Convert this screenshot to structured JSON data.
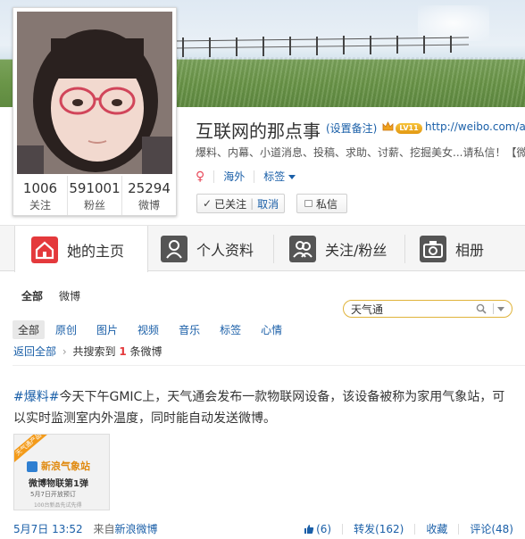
{
  "profile": {
    "name": "互联网的那点事",
    "set_remark": "(设置备注)",
    "level": "LV11",
    "url": "http://weibo.com/alib",
    "description": "爆料、内幕、小道消息、投稿、求助、讨薪、挖掘美女...请私信！【微",
    "location": "海外",
    "tags_label": "标签",
    "followed_label": "已关注",
    "cancel_label": "取消",
    "message_label": "私信"
  },
  "stats": [
    {
      "value": "1006",
      "label": "关注"
    },
    {
      "value": "591001",
      "label": "粉丝"
    },
    {
      "value": "25294",
      "label": "微博"
    }
  ],
  "tabs": [
    {
      "label": "她的主页",
      "icon": "home-icon"
    },
    {
      "label": "个人资料",
      "icon": "person-icon"
    },
    {
      "label": "关注/粉丝",
      "icon": "people-icon"
    },
    {
      "label": "相册",
      "icon": "camera-icon"
    }
  ],
  "subnav": {
    "all": "全部",
    "weibo": "微博"
  },
  "search": {
    "value": "天气通"
  },
  "filters": [
    "全部",
    "原创",
    "图片",
    "视频",
    "音乐",
    "标签",
    "心情"
  ],
  "result": {
    "back": "返回全部",
    "prefix": "共搜索到",
    "count": "1",
    "suffix": "条微博"
  },
  "post": {
    "tag": "#爆料#",
    "text": "今天下午GMIC上，天气通会发布一款物联网设备，该设备被称为家用气象站，可以实时监测室内外温度，同时能自动发送微博。",
    "image": {
      "ribbon": "天气通产品",
      "title": "新浪气象站",
      "subtitle": "微博物联第1弹",
      "line1": "5月7日开放预订",
      "line2": "100台新品先试先得"
    },
    "time": "5月7日 13:52",
    "source_prefix": "来自",
    "source": "新浪微博",
    "like_count": "(6)",
    "repost": "转发(162)",
    "favorite": "收藏",
    "comment": "评论(48)"
  },
  "colors": {
    "link": "#1a5fa8",
    "accent_red": "#e4393c",
    "tab_icon_active": "#e4393c",
    "tab_icon": "#555555"
  }
}
